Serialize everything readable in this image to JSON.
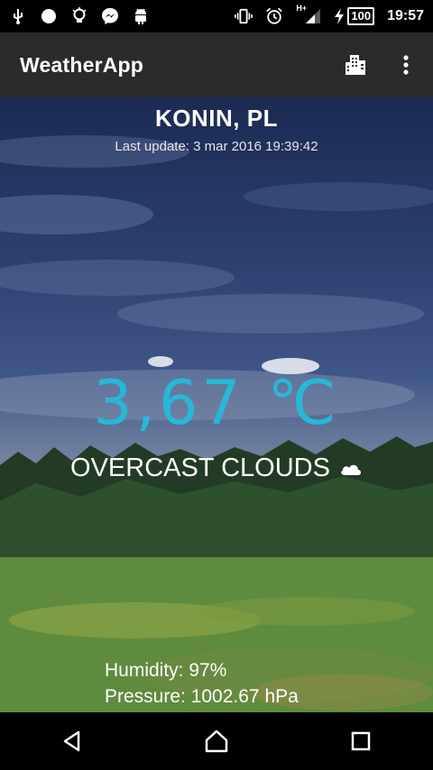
{
  "status_bar": {
    "time": "19:57",
    "battery": "100",
    "network_type": "H+",
    "icons": [
      "usb-icon",
      "record-icon",
      "bulb-icon",
      "messenger-icon",
      "android-icon",
      "vibrate-icon",
      "alarm-icon",
      "signal-icon",
      "charging-icon"
    ]
  },
  "app_bar": {
    "title": "WeatherApp",
    "actions": [
      "city-icon",
      "overflow-menu-icon"
    ]
  },
  "weather": {
    "city": "KONIN, PL",
    "last_update": "Last update: 3 mar 2016 19:39:42",
    "temperature": "3,67 ℃",
    "condition": "OVERCAST CLOUDS",
    "condition_icon": "cloud-icon",
    "humidity": "Humidity: 97%",
    "pressure": "Pressure: 1002.67 hPa"
  },
  "nav_bar": {
    "buttons": [
      "back-icon",
      "home-icon",
      "recents-icon"
    ]
  },
  "colors": {
    "accent": "#27b8d8",
    "app_bar": "#2b2b2b"
  }
}
